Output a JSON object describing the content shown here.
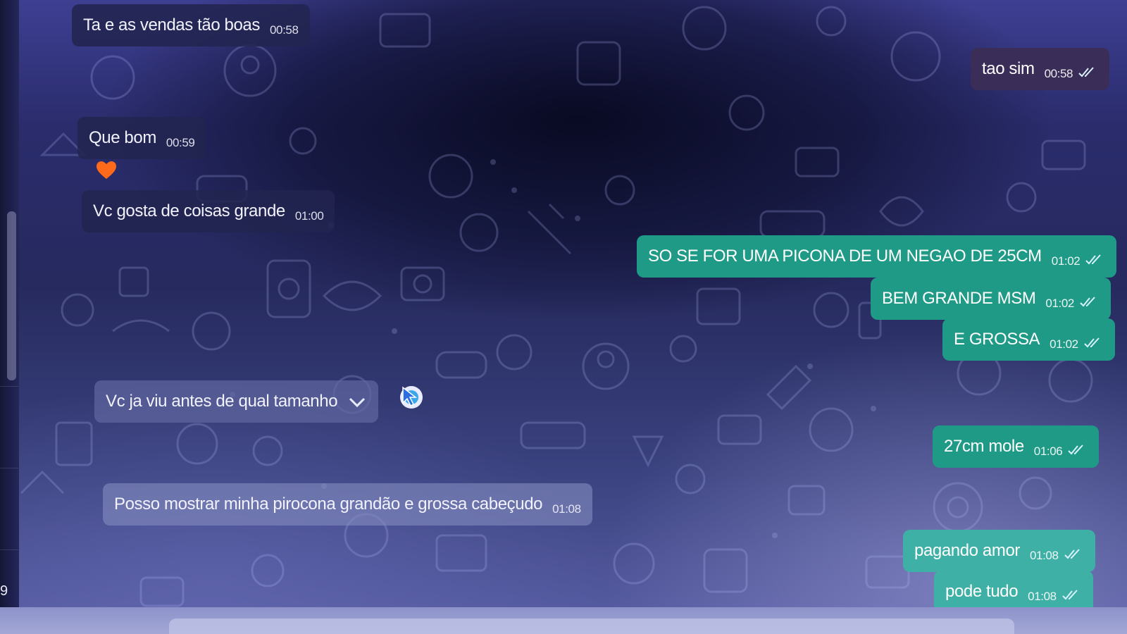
{
  "conversation": {
    "messages": [
      {
        "direction": "in",
        "text": "Ta e as vendas tão boas",
        "time": "00:58"
      },
      {
        "direction": "out",
        "text": "tao sim",
        "time": "00:58",
        "read": true
      },
      {
        "direction": "in",
        "text": "Que bom",
        "time": "00:59",
        "reaction": "heart-icon"
      },
      {
        "direction": "in",
        "text": "Vc gosta de coisas grande",
        "time": "01:00"
      },
      {
        "direction": "out",
        "text": "SO SE FOR UMA PICONA DE UM NEGAO DE 25CM",
        "time": "01:02",
        "read": true
      },
      {
        "direction": "out",
        "text": "BEM GRANDE MSM",
        "time": "01:02",
        "read": true
      },
      {
        "direction": "out",
        "text": "E GROSSA",
        "time": "01:02",
        "read": true
      },
      {
        "direction": "in",
        "text": "Vc ja viu antes de qual tamanho",
        "time": "",
        "menu": "chevron-down-icon"
      },
      {
        "direction": "out",
        "text": "27cm mole",
        "time": "01:06",
        "read": true
      },
      {
        "direction": "in",
        "text": "Posso mostrar  minha piroconа grandão e grossa cabeçudo",
        "time": "01:08"
      },
      {
        "direction": "out",
        "text": "pagando amor",
        "time": "01:08",
        "read": true
      },
      {
        "direction": "out",
        "text": "pode tudo",
        "time": "01:08",
        "read": true
      }
    ]
  },
  "sidebar": {
    "partial_text": "9"
  },
  "colors": {
    "incoming_bubble": "#222450",
    "outgoing_bubble": "#1f9a86",
    "outgoing_bubble_top": "#3a2d58",
    "reaction_heart": "#ff6a1a",
    "read_ticks": "#d8f3ff"
  }
}
